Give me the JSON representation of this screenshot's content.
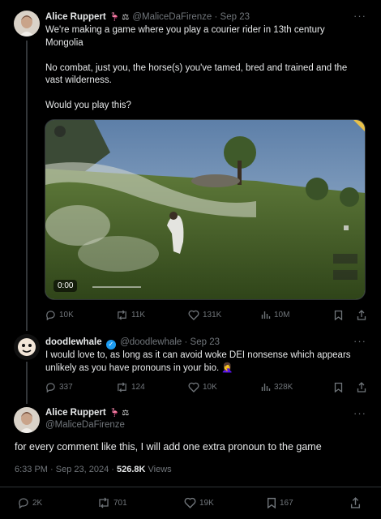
{
  "tweet1": {
    "name": "Alice Ruppert",
    "emoji": "🦩 ⚖",
    "handle": "@MaliceDaFirenze",
    "time": "· Sep 23",
    "text": "We're making a game where you play a courier rider in 13th century\nMongolia\n\nNo combat, just you, the horse(s) you've tamed, bred and trained and the\nvast wilderness.\n\nWould you play this?",
    "video_time": "0:00",
    "actions": {
      "replies": "10K",
      "retweets": "11K",
      "likes": "131K",
      "views": "10M"
    }
  },
  "reply": {
    "name": "doodlewhale",
    "handle": "@doodlewhale",
    "time": "· Sep 23",
    "text": "I would love to, as long as it can avoid woke DEI nonsense which appears\nunlikely as you have pronouns in your bio. 🤦‍♀️",
    "actions": {
      "replies": "337",
      "retweets": "124",
      "likes": "10K",
      "views": "328K"
    }
  },
  "main": {
    "name": "Alice Ruppert",
    "emoji": "🦩 ⚖",
    "handle": "@MaliceDaFirenze",
    "text": "for every comment like this, I will add one extra pronoun to the game",
    "timestamp": "6:33 PM · Sep 23, 2024 · ",
    "views_count": "526.8K",
    "views_label": " Views",
    "actions": {
      "replies": "2K",
      "retweets": "701",
      "likes": "19K",
      "bookmarks": "167"
    }
  },
  "colors": {
    "background": "#000000",
    "text": "#e7e9ea",
    "muted": "#71767b",
    "verified": "#1d9bf0",
    "divider": "#2f3336"
  }
}
